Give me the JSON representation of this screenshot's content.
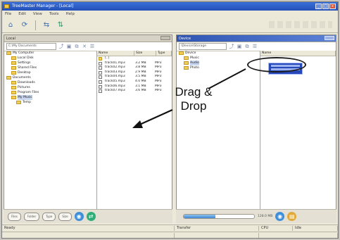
{
  "window": {
    "title": "TreeMaster Manager - [Local]",
    "controls": [
      "_",
      "□",
      "x"
    ]
  },
  "menu": [
    "File",
    "Edit",
    "View",
    "Tools",
    "Help"
  ],
  "left_pane": {
    "title": "Local",
    "address": "C:\\My Documents",
    "tree": [
      {
        "label": "My Computer",
        "level": 0
      },
      {
        "label": "Local Disk",
        "level": 1
      },
      {
        "label": "Settings",
        "level": 1
      },
      {
        "label": "Shared Files",
        "level": 1
      },
      {
        "label": "Desktop",
        "level": 1
      },
      {
        "label": "Documents",
        "level": 0
      },
      {
        "label": "Downloads",
        "level": 1
      },
      {
        "label": "Pictures",
        "level": 1
      },
      {
        "label": "Program Files",
        "level": 1
      },
      {
        "label": "My Music",
        "level": 1,
        "selected": true
      },
      {
        "label": "Temp",
        "level": 2
      }
    ],
    "columns": [
      "Name",
      "Size",
      "Type"
    ],
    "files": [
      {
        "name": "[..]",
        "size": "",
        "type": "",
        "folder": true
      },
      {
        "name": "track01.mp3",
        "size": "3.2 MB",
        "type": "MP3"
      },
      {
        "name": "track02.mp3",
        "size": "3.8 MB",
        "type": "MP3"
      },
      {
        "name": "track03.mp3",
        "size": "2.9 MB",
        "type": "MP3"
      },
      {
        "name": "track04.mp3",
        "size": "3.5 MB",
        "type": "MP3"
      },
      {
        "name": "track05.mp3",
        "size": "4.0 MB",
        "type": "MP3"
      },
      {
        "name": "track06.mp3",
        "size": "3.1 MB",
        "type": "MP3"
      },
      {
        "name": "track07.mp3",
        "size": "3.6 MB",
        "type": "MP3"
      }
    ]
  },
  "right_pane": {
    "title": "Device",
    "address": "\\Device\\Storage",
    "tree": [
      {
        "label": "Device",
        "level": 0
      },
      {
        "label": "Music",
        "level": 1
      },
      {
        "label": "Audio",
        "level": 1,
        "selected": true
      },
      {
        "label": "Photo",
        "level": 1
      }
    ],
    "columns": [
      "Name"
    ],
    "selected_files": [
      "selected file 1",
      "selected file 2"
    ]
  },
  "bottom_left": {
    "buttons": [
      "Files",
      "Folder",
      "Type",
      "Size"
    ]
  },
  "bottom_right": {
    "progress_percent": 0.45,
    "capacity": "128.0 MB"
  },
  "status": {
    "left": [
      "Ready",
      "",
      ""
    ],
    "right": [
      "Transfer",
      "",
      "CPU",
      "Idle"
    ]
  },
  "annotation": {
    "line1": "Drag &",
    "line2": "Drop"
  }
}
